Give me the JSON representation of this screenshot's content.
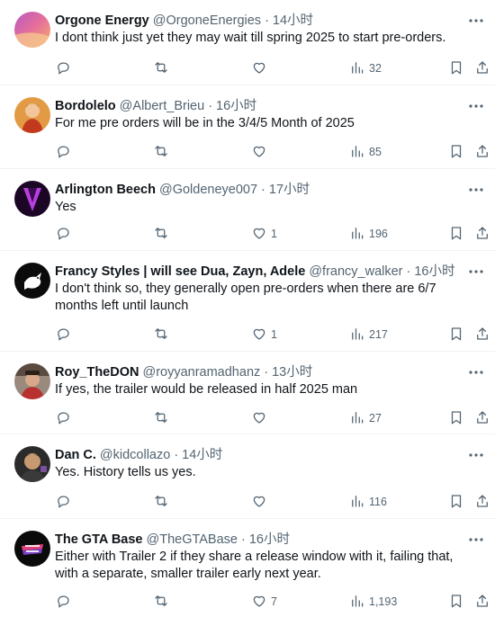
{
  "tweets": [
    {
      "name": "Orgone Energy",
      "handle": "@OrgoneEnergies",
      "sep": "·",
      "time": "14小时",
      "text": "I dont think just yet they may wait till spring 2025 to start pre-orders.",
      "replies": "",
      "retweets": "",
      "likes": "",
      "views": "32",
      "avatar_colors": [
        "#d46aa0",
        "#f2a36b"
      ]
    },
    {
      "name": "Bordolelo",
      "handle": "@Albert_Brieu",
      "sep": "·",
      "time": "16小时",
      "text": "For me pre orders will be in the 3/4/5 Month of 2025",
      "replies": "",
      "retweets": "",
      "likes": "",
      "views": "85",
      "avatar_colors": [
        "#c4582a",
        "#f0a64b"
      ]
    },
    {
      "name": "Arlington Beech",
      "handle": "@Goldeneye007",
      "sep": "·",
      "time": "17小时",
      "text": "Yes",
      "replies": "",
      "retweets": "",
      "likes": "1",
      "views": "196",
      "avatar_colors": [
        "#2b0a3d",
        "#b03ad6"
      ]
    },
    {
      "name": "Francy Styles | will see Dua, Zayn, Adele",
      "handle": "@francy_walker",
      "sep": "·",
      "time": "16小时",
      "text": "I don't think so, they generally open pre-orders when there are 6/7 months left until launch",
      "replies": "",
      "retweets": "",
      "likes": "1",
      "views": "217",
      "avatar_colors": [
        "#0c0c0c",
        "#ffffff"
      ]
    },
    {
      "name": "Roy_TheDON",
      "handle": "@royyanramadhanz",
      "sep": "·",
      "time": "13小时",
      "text": "If yes, the trailer would be released in half 2025 man",
      "replies": "",
      "retweets": "",
      "likes": "",
      "views": "27",
      "avatar_colors": [
        "#8a6b5a",
        "#c23b3b"
      ]
    },
    {
      "name": "Dan C.",
      "handle": "@kidcollazo",
      "sep": "·",
      "time": "14小时",
      "text": "Yes. History tells us yes.",
      "replies": "",
      "retweets": "",
      "likes": "",
      "views": "116",
      "avatar_colors": [
        "#2a2a2a",
        "#c9a77a"
      ]
    },
    {
      "name": "The GTA Base",
      "handle": "@TheGTABase",
      "sep": "·",
      "time": "16小时",
      "text": "Either with Trailer 2 if they share a release window with it, failing that, with a separate, smaller trailer early next year.",
      "replies": "",
      "retweets": "",
      "likes": "7",
      "views": "1,193",
      "avatar_colors": [
        "#0a0a0a",
        "#e0407a"
      ]
    }
  ]
}
